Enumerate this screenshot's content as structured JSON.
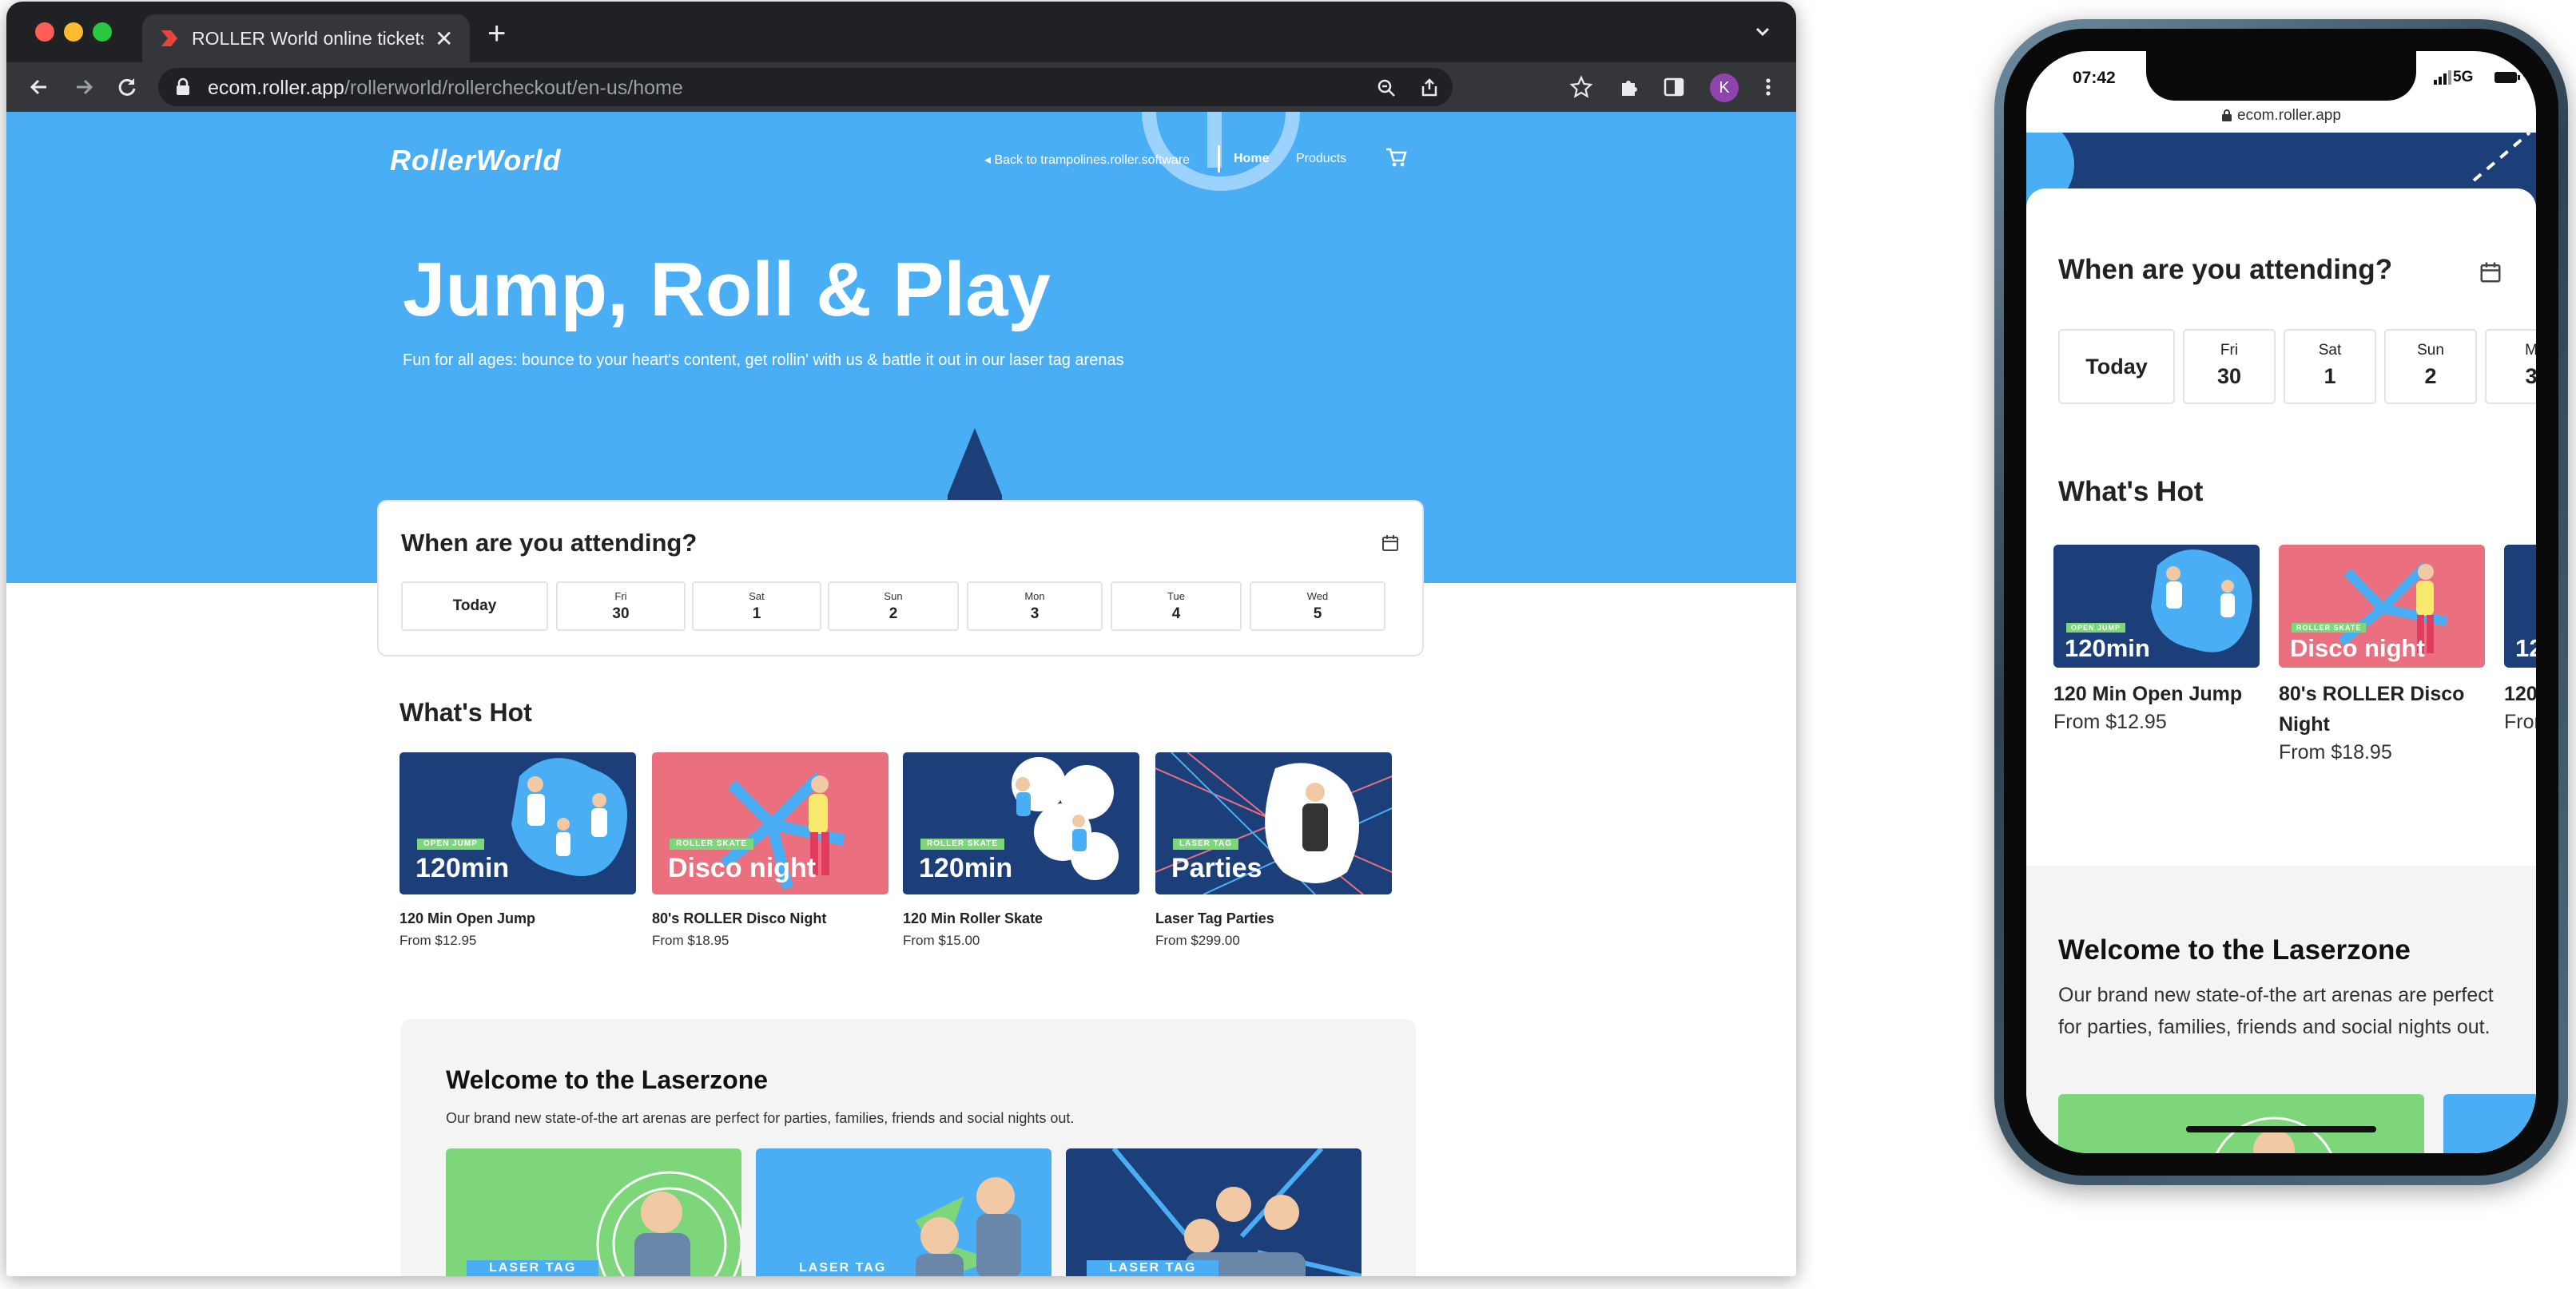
{
  "colors": {
    "hero_blue": "#4aaef5",
    "navy": "#1c3f7a",
    "pink": "#ea6f7f",
    "green": "#7ed67a",
    "browser_dark": "#202124",
    "browser_toolbar": "#35363a"
  },
  "browser": {
    "tab_title": "ROLLER World online tickets - ",
    "tab_close": "✕",
    "new_tab": "+",
    "url_host": "ecom.roller.app",
    "url_path": "/rollerworld/rollercheckout/en-us/home",
    "profile_initial": "K",
    "icons": [
      "back-icon",
      "forward-icon",
      "reload-icon",
      "lock-icon",
      "zoom-icon",
      "share-icon",
      "star-icon",
      "extensions-icon",
      "sidepanel-icon",
      "menu-icon"
    ]
  },
  "site": {
    "logo": "RollerWorld",
    "nav": {
      "back_link": "Back to trampolines.roller.software",
      "home": "Home",
      "products": "Products"
    },
    "hero": {
      "title": "Jump, Roll & Play",
      "subtitle": "Fun for all ages: bounce to your heart's content, get rollin' with us & battle it out in our laser tag arenas"
    },
    "attend": {
      "title": "When are you attending?",
      "today": "Today",
      "dates": [
        {
          "day": "Fri",
          "num": "30"
        },
        {
          "day": "Sat",
          "num": "1"
        },
        {
          "day": "Sun",
          "num": "2"
        },
        {
          "day": "Mon",
          "num": "3"
        },
        {
          "day": "Tue",
          "num": "4"
        },
        {
          "day": "Wed",
          "num": "5"
        }
      ]
    },
    "whats_hot": {
      "title": "What's Hot",
      "products": [
        {
          "name": "120 Min Open Jump",
          "price": "From $12.95",
          "tag": "OPEN JUMP",
          "big": "120min"
        },
        {
          "name": "80's ROLLER Disco Night",
          "price": "From $18.95",
          "tag": "ROLLER SKATE",
          "big": "Disco night"
        },
        {
          "name": "120 Min Roller Skate",
          "price": "From $15.00",
          "tag": "ROLLER SKATE",
          "big": "120min"
        },
        {
          "name": "Laser Tag Parties",
          "price": "From $299.00",
          "tag": "LASER TAG",
          "big": "Parties"
        }
      ]
    },
    "laser": {
      "title": "Welcome to the Laserzone",
      "desc": "Our brand new state-of-the art arenas are perfect for parties, families, friends and social nights out.",
      "card_tag": "LASER TAG"
    }
  },
  "phone": {
    "time": "07:42",
    "network": "5G",
    "url": "ecom.roller.app",
    "attend_title": "When are you attending?",
    "today": "Today",
    "dates": [
      {
        "day": "Fri",
        "num": "30"
      },
      {
        "day": "Sat",
        "num": "1"
      },
      {
        "day": "Sun",
        "num": "2"
      },
      {
        "day": "M",
        "num": "3"
      }
    ],
    "whats_hot": "What's Hot",
    "products": [
      {
        "name": "120 Min Open Jump",
        "price": "From $12.95",
        "tag": "OPEN JUMP",
        "big": "120min"
      },
      {
        "name": "80's ROLLER Disco Night",
        "price": "From $18.95",
        "tag": "ROLLER SKATE",
        "big": "Disco night"
      },
      {
        "name": "120",
        "price": "From",
        "tag": "",
        "big": "12"
      }
    ],
    "laser_title": "Welcome to the Laserzone",
    "laser_desc": "Our brand new state-of-the art arenas are perfect for parties, families, friends and social nights out."
  }
}
